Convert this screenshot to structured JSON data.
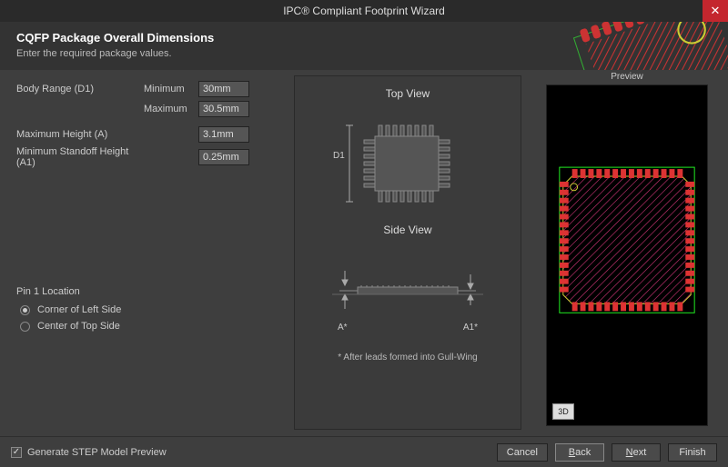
{
  "window": {
    "title": "IPC® Compliant Footprint Wizard"
  },
  "header": {
    "title": "CQFP Package Overall Dimensions",
    "subtitle": "Enter the required package values."
  },
  "form": {
    "body_range": {
      "label": "Body Range (D1)",
      "min_label": "Minimum",
      "min": "30mm",
      "max_label": "Maximum",
      "max": "30.5mm"
    },
    "max_height": {
      "label": "Maximum Height (A)",
      "value": "3.1mm"
    },
    "min_standoff": {
      "label": "Minimum Standoff Height (A1)",
      "value": "0.25mm"
    }
  },
  "pin1": {
    "section": "Pin 1 Location",
    "opt1": "Corner of Left Side",
    "opt2": "Center of Top Side",
    "selected": "opt1"
  },
  "diagram": {
    "top_view": "Top View",
    "d1": "D1",
    "side_view": "Side View",
    "a_star": "A*",
    "a1_star": "A1*",
    "note": "* After leads formed into Gull-Wing"
  },
  "preview": {
    "label": "Preview",
    "btn_3d": "3D"
  },
  "footer": {
    "step_checked": true,
    "step_label": "Generate STEP Model Preview",
    "cancel": "Cancel",
    "back": "Back",
    "next": "Next",
    "finish": "Finish"
  }
}
